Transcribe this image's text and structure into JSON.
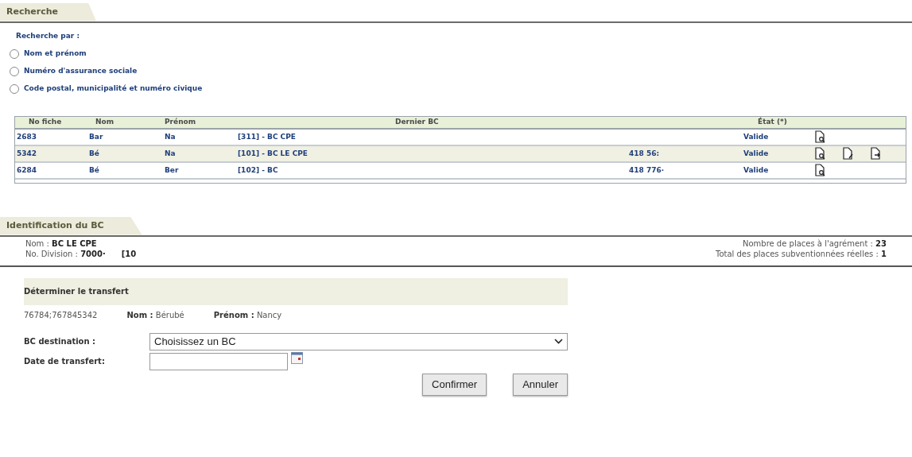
{
  "search_section": {
    "title": "Recherche",
    "prompt": "Recherche par :",
    "options": [
      {
        "label": "Nom et prénom",
        "selected": false
      },
      {
        "label": "Numéro d'assurance sociale",
        "selected": false
      },
      {
        "label": "Code postal, municipalité et numéro civique",
        "selected": false
      }
    ]
  },
  "table": {
    "columns": [
      "No fiche",
      "Nom",
      "Prénom",
      "Dernier BC",
      "État (*)"
    ],
    "rows": [
      {
        "no_fiche": "2683",
        "nom": "Bar",
        "prenom": "Na",
        "dernier_bc": "[311] - BC CPE",
        "telephone": "",
        "etat": "Valide",
        "selected": false,
        "actions": [
          {
            "kind": "view"
          }
        ]
      },
      {
        "no_fiche": "5342",
        "nom": "Bé",
        "prenom": "Na",
        "dernier_bc": "[101] - BC LE CPE",
        "telephone": "418 56:",
        "etat": "Valide",
        "selected": true,
        "actions": [
          {
            "kind": "view"
          },
          {
            "kind": "edit"
          },
          {
            "kind": "transfer"
          }
        ]
      },
      {
        "no_fiche": "6284",
        "nom": "Bé",
        "prenom": "Ber",
        "dernier_bc": "[102] - BC",
        "telephone": "418 776·",
        "etat": "Valide",
        "selected": false,
        "actions": [
          {
            "kind": "view"
          }
        ]
      }
    ]
  },
  "identification": {
    "title": "Identification du BC",
    "nom_label": "Nom :",
    "nom_value": "BC LE CPE",
    "division_label": "No. Division :",
    "division_value": "7000·",
    "division_extra": "[10",
    "places_label": "Nombre de places à l'agrément :",
    "places_value": "23",
    "total_label": "Total des places subventionnées réelles :",
    "total_value": "1"
  },
  "transfer": {
    "title": "Déterminer le transfert",
    "ids": "76784;767845342",
    "nom_label": "Nom :",
    "nom_value": "Bérubé",
    "prenom_label": "Prénom :",
    "prenom_value": "Nancy",
    "destination_label": "BC destination :",
    "destination_value": "Choisissez un BC",
    "date_label": "Date de transfert:",
    "buttons": [
      "Confirmer",
      "Annuler"
    ]
  }
}
